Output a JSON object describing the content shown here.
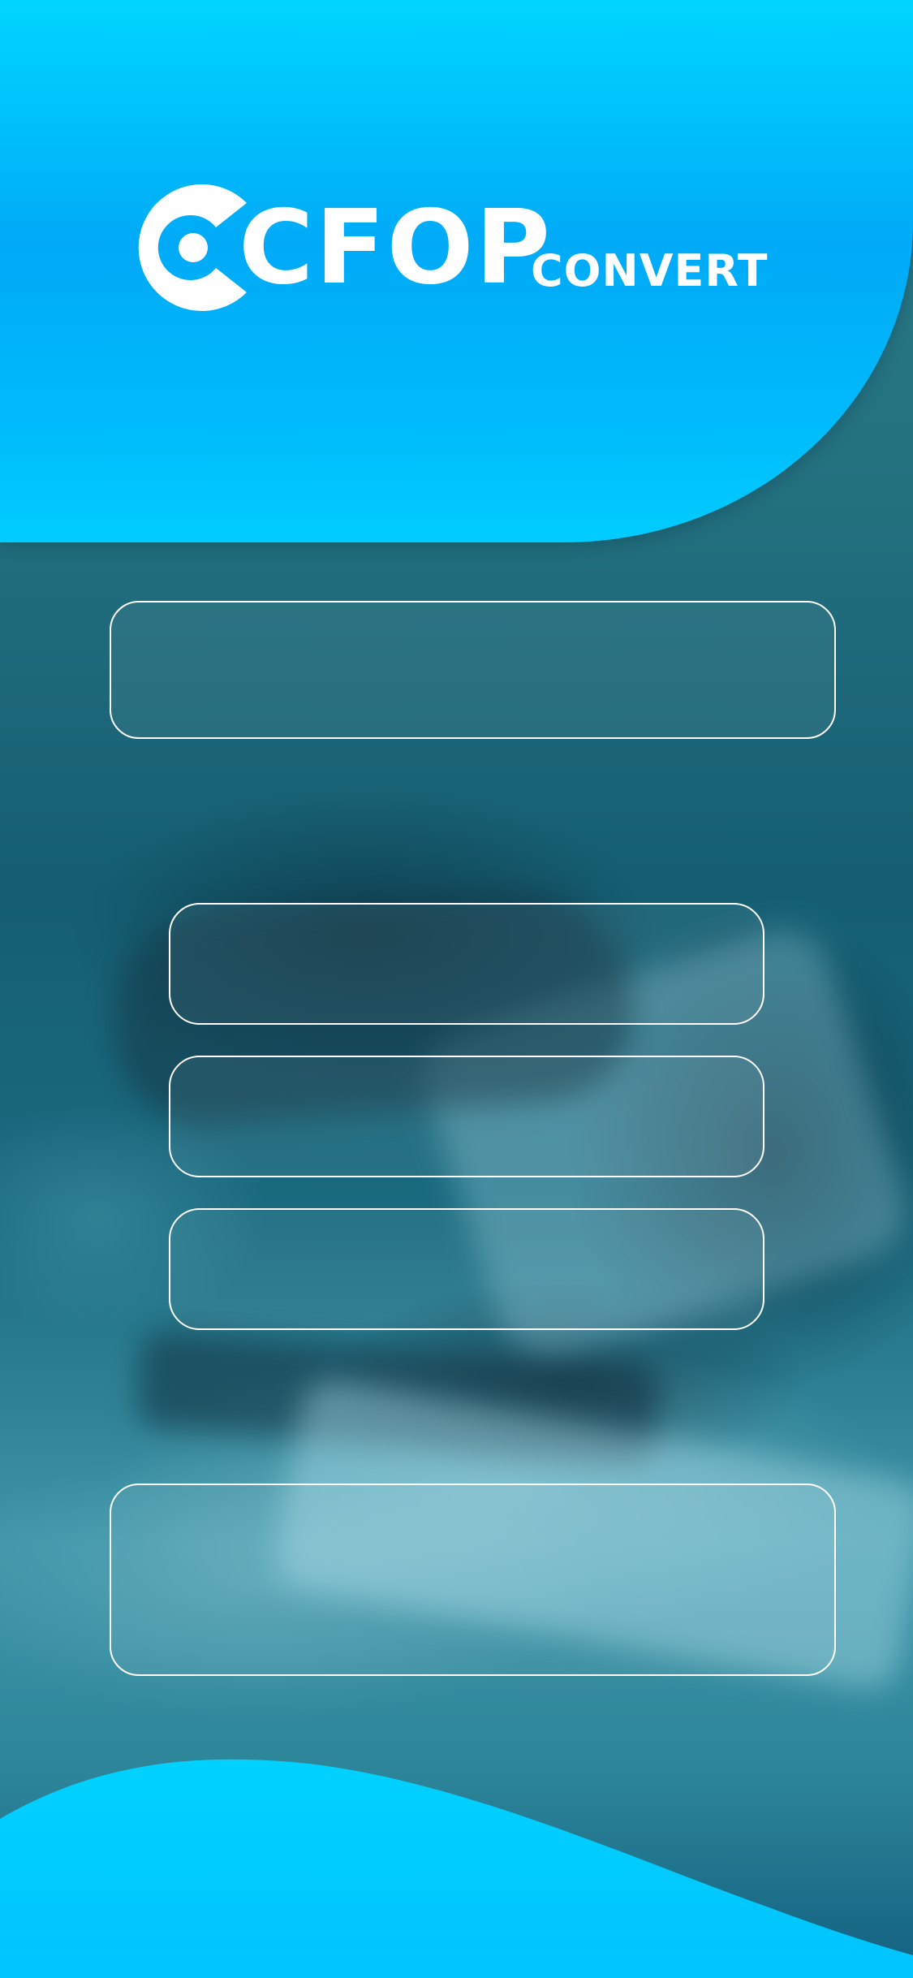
{
  "brand": {
    "name_main": "CFOP",
    "name_sub": "CONVERT",
    "logo_icon": "c-circle-logo-icon"
  },
  "colors": {
    "header_top": "#00d6ff",
    "header_mid": "#00aaf7",
    "accent": "#00c8ff",
    "outline": "#ffffff"
  },
  "main": {
    "title_box_text": "",
    "options": [
      {
        "label": ""
      },
      {
        "label": ""
      },
      {
        "label": ""
      }
    ],
    "footer_box_text": ""
  }
}
